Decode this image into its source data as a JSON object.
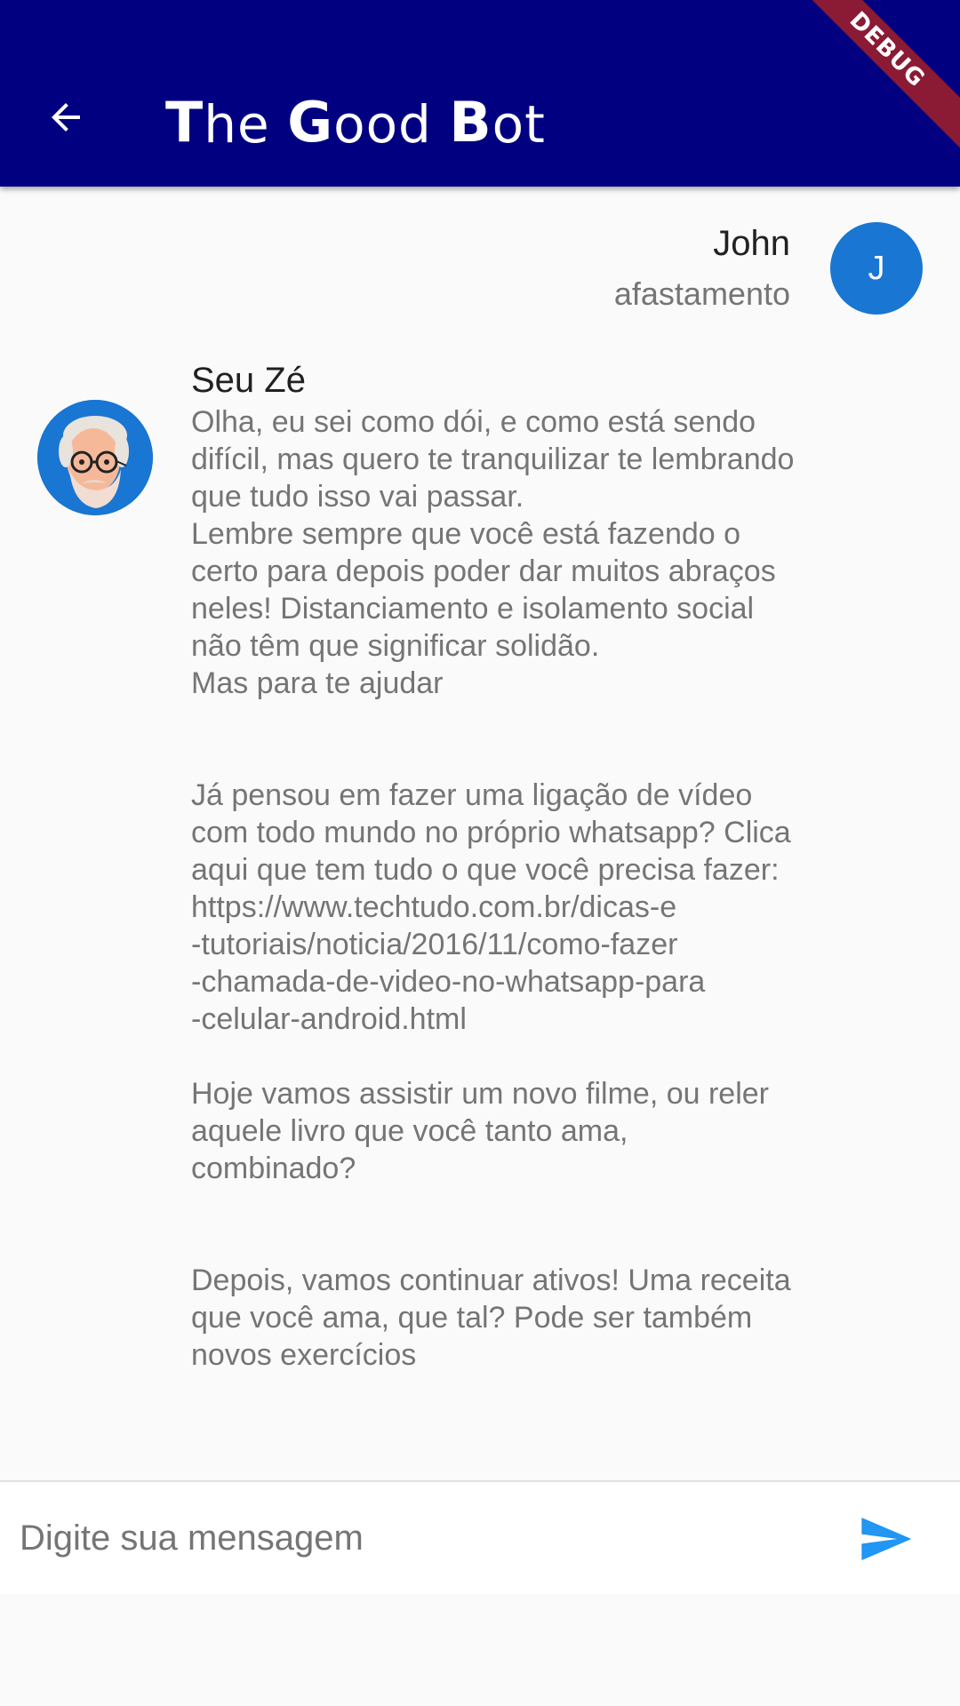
{
  "app_bar": {
    "title_parts": [
      {
        "cap": "T",
        "rest": "he"
      },
      {
        "cap": "G",
        "rest": "ood"
      },
      {
        "cap": "B",
        "rest": "ot"
      }
    ],
    "debug_banner": "DEBUG",
    "background_color": "#000080",
    "back_icon": "arrow-back-icon"
  },
  "messages": [
    {
      "sender": "John",
      "text": "afastamento",
      "avatar_initial": "J",
      "avatar_color": "#1976d2"
    },
    {
      "sender": "Seu Zé",
      "avatar_icon": "old-man-avatar-icon",
      "text": "Olha, eu sei como dói, e como está sendo difícil, mas quero te tranquilizar te lembrando que tudo isso vai passar.\nLembre sempre que você está fazendo o certo para depois poder dar muitos abraços neles! Distanciamento e isolamento social não têm que significar solidão.\nMas para te ajudar\n\n\nJá pensou em fazer uma ligação de vídeo com todo mundo no próprio whatsapp? Clica aqui que tem tudo o que você precisa fazer:\nhttps://www.techtudo.com.br/dicas-e\n-tutoriais/noticia/2016/11/como-fazer\n-chamada-de-video-no-whatsapp-para\n-celular-android.html\n\nHoje vamos assistir um novo filme, ou reler aquele livro que você tanto ama, combinado?\n\n\nDepois, vamos continuar ativos! Uma receita que você ama, que tal? Pode ser também novos exercícios"
    }
  ],
  "composer": {
    "placeholder": "Digite sua mensagem",
    "value": "",
    "send_icon": "send-icon",
    "send_color": "#2196f3"
  }
}
